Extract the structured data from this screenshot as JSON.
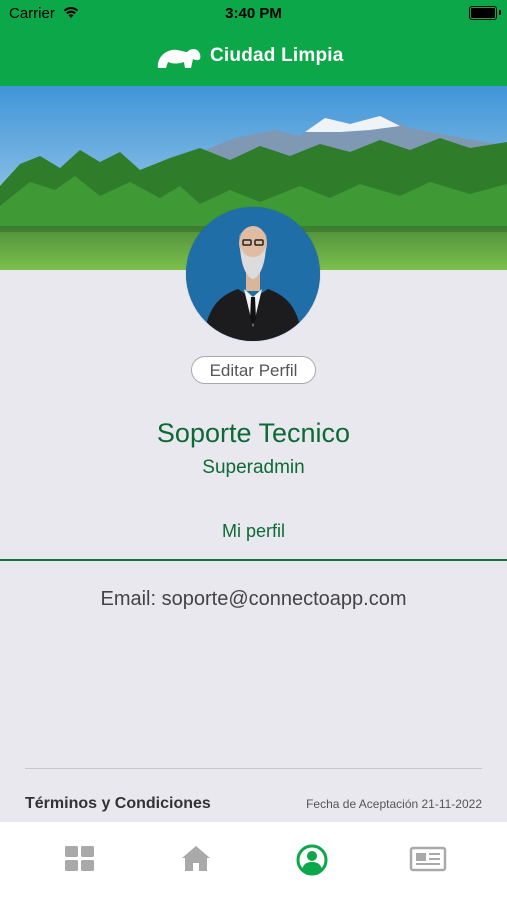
{
  "status_bar": {
    "carrier": "Carrier",
    "time": "3:40 PM"
  },
  "header": {
    "title": "Ciudad Limpia",
    "logo_icon": "hippo-logo-icon"
  },
  "profile": {
    "edit_label": "Editar Perfil",
    "name": "Soporte Tecnico",
    "role": "Superadmin"
  },
  "tabs": {
    "active_label": "Mi perfil"
  },
  "details": {
    "email": "Email: soporte@connectoapp.com"
  },
  "footer": {
    "terms_label": "Términos y Condiciones",
    "acceptance_date": "Fecha de Aceptación 21-11-2022"
  },
  "bottom_nav": {
    "items": [
      {
        "icon": "grid-icon",
        "active": false
      },
      {
        "icon": "home-icon",
        "active": false
      },
      {
        "icon": "user-icon",
        "active": true
      },
      {
        "icon": "newspaper-icon",
        "active": false
      }
    ]
  },
  "colors": {
    "brand": "#0ba748",
    "accent_text": "#0d6a35",
    "inactive_icon": "#a9a9a9",
    "background": "#e9e8ee"
  }
}
